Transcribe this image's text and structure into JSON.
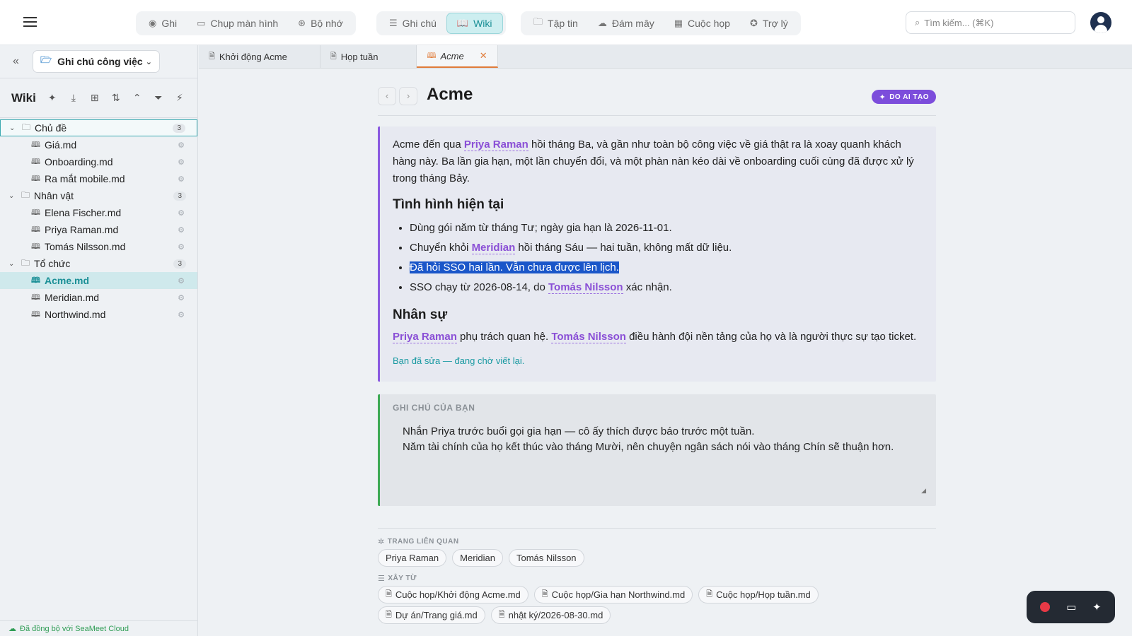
{
  "topbar": {
    "group1": [
      {
        "icon": "record-icon",
        "glyph": "◉",
        "label": "Ghi"
      },
      {
        "icon": "screenshot-icon",
        "glyph": "▭",
        "label": "Chụp màn hình"
      },
      {
        "icon": "memory-icon",
        "glyph": "⊛",
        "label": "Bộ nhớ"
      }
    ],
    "group2": [
      {
        "icon": "notes-icon",
        "glyph": "☰",
        "label": "Ghi chú"
      },
      {
        "icon": "wiki-icon",
        "glyph": "📖",
        "label": "Wiki",
        "active": true
      }
    ],
    "group3": [
      {
        "icon": "files-icon",
        "glyph": "🗀",
        "label": "Tập tin"
      },
      {
        "icon": "cloud-icon",
        "glyph": "☁",
        "label": "Đám mây"
      },
      {
        "icon": "calendar-icon",
        "glyph": "▦",
        "label": "Cuộc họp"
      },
      {
        "icon": "assistant-icon",
        "glyph": "✪",
        "label": "Trợ lý"
      }
    ],
    "search_placeholder": "Tìm kiếm... (⌘K)"
  },
  "sidebar": {
    "workspace": "Ghi chú công việc",
    "section_title": "Wiki",
    "tree": [
      {
        "label": "Chủ đề",
        "count": "3",
        "selected": true,
        "files": [
          {
            "label": "Giá.md"
          },
          {
            "label": "Onboarding.md"
          },
          {
            "label": "Ra mắt mobile.md"
          }
        ]
      },
      {
        "label": "Nhân vật",
        "count": "3",
        "files": [
          {
            "label": "Elena Fischer.md"
          },
          {
            "label": "Priya Raman.md"
          },
          {
            "label": "Tomás Nilsson.md"
          }
        ]
      },
      {
        "label": "Tổ chức",
        "count": "3",
        "files": [
          {
            "label": "Acme.md",
            "active": true
          },
          {
            "label": "Meridian.md"
          },
          {
            "label": "Northwind.md"
          }
        ]
      }
    ],
    "sync_status": "Đã đồng bộ với SeaMeet Cloud"
  },
  "tabs": [
    {
      "label": "Khởi động Acme"
    },
    {
      "label": "Họp tuần"
    },
    {
      "label": "Acme",
      "active": true
    }
  ],
  "page": {
    "title": "Acme",
    "ai_badge": "DO AI TẠO",
    "intro": {
      "t1": "Acme đến qua ",
      "link1": "Priya Raman",
      "t2": " hồi tháng Ba, và gần như toàn bộ công việc về giá thật ra là xoay quanh khách hàng này. Ba lần gia hạn, một lần chuyển đổi, và một phàn nàn kéo dài về onboarding cuối cùng đã được xử lý trong tháng Bảy."
    },
    "h_status": "Tình hình hiện tại",
    "status": {
      "b1": "Dùng gói năm từ tháng Tư; ngày gia hạn là 2026-11-01.",
      "b2_t1": "Chuyển khỏi ",
      "b2_link": "Meridian",
      "b2_t2": " hồi tháng Sáu — hai tuần, không mất dữ liệu.",
      "b3": "Đã hỏi SSO hai lần. Vẫn chưa được lên lịch.",
      "b4_t1": "SSO chạy từ 2026-08-14, do ",
      "b4_link": "Tomás Nilsson",
      "b4_t2": " xác nhận."
    },
    "h_people": "Nhân sự",
    "people": {
      "link1": "Priya Raman",
      "t1": " phụ trách quan hệ. ",
      "link2": "Tomás Nilsson",
      "t2": " điều hành đội nền tảng của họ và là người thực sự tạo ticket."
    },
    "edited_note": "Bạn đã sửa — đang chờ viết lại.",
    "your_notes_label": "GHI CHÚ CỦA BẠN",
    "your_notes": "Nhắn Priya trước buổi gọi gia hạn — cô ấy thích được báo trước một tuần.\nNăm tài chính của họ kết thúc vào tháng Mười, nên chuyện ngân sách nói vào tháng Chín sẽ thuận hơn.",
    "related_label": "TRANG LIÊN QUAN",
    "related": [
      "Priya Raman",
      "Meridian",
      "Tomás Nilsson"
    ],
    "built_from_label": "XÂY TỪ",
    "built_from": [
      "Cuộc họp/Khởi động Acme.md",
      "Cuộc họp/Gia hạn Northwind.md",
      "Cuộc họp/Họp tuần.md",
      "Dự án/Trang giá.md",
      "nhật ký/2026-08-30.md"
    ]
  }
}
